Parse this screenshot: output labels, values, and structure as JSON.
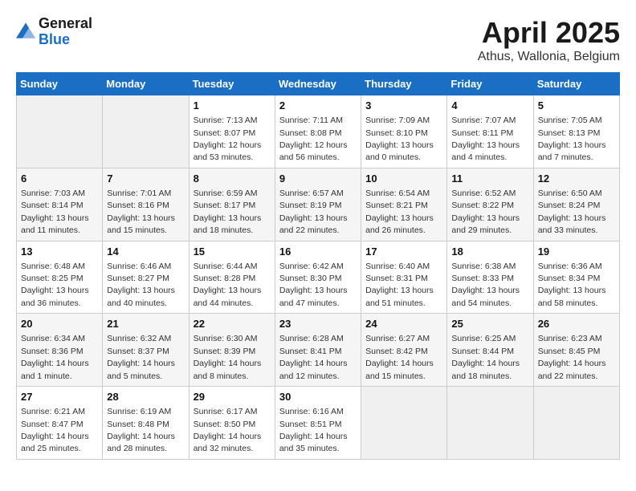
{
  "logo": {
    "general": "General",
    "blue": "Blue"
  },
  "header": {
    "title": "April 2025",
    "location": "Athus, Wallonia, Belgium"
  },
  "weekdays": [
    "Sunday",
    "Monday",
    "Tuesday",
    "Wednesday",
    "Thursday",
    "Friday",
    "Saturday"
  ],
  "weeks": [
    [
      {
        "day": "",
        "empty": true
      },
      {
        "day": "",
        "empty": true
      },
      {
        "day": "1",
        "sunrise": "Sunrise: 7:13 AM",
        "sunset": "Sunset: 8:07 PM",
        "daylight": "Daylight: 12 hours and 53 minutes."
      },
      {
        "day": "2",
        "sunrise": "Sunrise: 7:11 AM",
        "sunset": "Sunset: 8:08 PM",
        "daylight": "Daylight: 12 hours and 56 minutes."
      },
      {
        "day": "3",
        "sunrise": "Sunrise: 7:09 AM",
        "sunset": "Sunset: 8:10 PM",
        "daylight": "Daylight: 13 hours and 0 minutes."
      },
      {
        "day": "4",
        "sunrise": "Sunrise: 7:07 AM",
        "sunset": "Sunset: 8:11 PM",
        "daylight": "Daylight: 13 hours and 4 minutes."
      },
      {
        "day": "5",
        "sunrise": "Sunrise: 7:05 AM",
        "sunset": "Sunset: 8:13 PM",
        "daylight": "Daylight: 13 hours and 7 minutes."
      }
    ],
    [
      {
        "day": "6",
        "sunrise": "Sunrise: 7:03 AM",
        "sunset": "Sunset: 8:14 PM",
        "daylight": "Daylight: 13 hours and 11 minutes."
      },
      {
        "day": "7",
        "sunrise": "Sunrise: 7:01 AM",
        "sunset": "Sunset: 8:16 PM",
        "daylight": "Daylight: 13 hours and 15 minutes."
      },
      {
        "day": "8",
        "sunrise": "Sunrise: 6:59 AM",
        "sunset": "Sunset: 8:17 PM",
        "daylight": "Daylight: 13 hours and 18 minutes."
      },
      {
        "day": "9",
        "sunrise": "Sunrise: 6:57 AM",
        "sunset": "Sunset: 8:19 PM",
        "daylight": "Daylight: 13 hours and 22 minutes."
      },
      {
        "day": "10",
        "sunrise": "Sunrise: 6:54 AM",
        "sunset": "Sunset: 8:21 PM",
        "daylight": "Daylight: 13 hours and 26 minutes."
      },
      {
        "day": "11",
        "sunrise": "Sunrise: 6:52 AM",
        "sunset": "Sunset: 8:22 PM",
        "daylight": "Daylight: 13 hours and 29 minutes."
      },
      {
        "day": "12",
        "sunrise": "Sunrise: 6:50 AM",
        "sunset": "Sunset: 8:24 PM",
        "daylight": "Daylight: 13 hours and 33 minutes."
      }
    ],
    [
      {
        "day": "13",
        "sunrise": "Sunrise: 6:48 AM",
        "sunset": "Sunset: 8:25 PM",
        "daylight": "Daylight: 13 hours and 36 minutes."
      },
      {
        "day": "14",
        "sunrise": "Sunrise: 6:46 AM",
        "sunset": "Sunset: 8:27 PM",
        "daylight": "Daylight: 13 hours and 40 minutes."
      },
      {
        "day": "15",
        "sunrise": "Sunrise: 6:44 AM",
        "sunset": "Sunset: 8:28 PM",
        "daylight": "Daylight: 13 hours and 44 minutes."
      },
      {
        "day": "16",
        "sunrise": "Sunrise: 6:42 AM",
        "sunset": "Sunset: 8:30 PM",
        "daylight": "Daylight: 13 hours and 47 minutes."
      },
      {
        "day": "17",
        "sunrise": "Sunrise: 6:40 AM",
        "sunset": "Sunset: 8:31 PM",
        "daylight": "Daylight: 13 hours and 51 minutes."
      },
      {
        "day": "18",
        "sunrise": "Sunrise: 6:38 AM",
        "sunset": "Sunset: 8:33 PM",
        "daylight": "Daylight: 13 hours and 54 minutes."
      },
      {
        "day": "19",
        "sunrise": "Sunrise: 6:36 AM",
        "sunset": "Sunset: 8:34 PM",
        "daylight": "Daylight: 13 hours and 58 minutes."
      }
    ],
    [
      {
        "day": "20",
        "sunrise": "Sunrise: 6:34 AM",
        "sunset": "Sunset: 8:36 PM",
        "daylight": "Daylight: 14 hours and 1 minute."
      },
      {
        "day": "21",
        "sunrise": "Sunrise: 6:32 AM",
        "sunset": "Sunset: 8:37 PM",
        "daylight": "Daylight: 14 hours and 5 minutes."
      },
      {
        "day": "22",
        "sunrise": "Sunrise: 6:30 AM",
        "sunset": "Sunset: 8:39 PM",
        "daylight": "Daylight: 14 hours and 8 minutes."
      },
      {
        "day": "23",
        "sunrise": "Sunrise: 6:28 AM",
        "sunset": "Sunset: 8:41 PM",
        "daylight": "Daylight: 14 hours and 12 minutes."
      },
      {
        "day": "24",
        "sunrise": "Sunrise: 6:27 AM",
        "sunset": "Sunset: 8:42 PM",
        "daylight": "Daylight: 14 hours and 15 minutes."
      },
      {
        "day": "25",
        "sunrise": "Sunrise: 6:25 AM",
        "sunset": "Sunset: 8:44 PM",
        "daylight": "Daylight: 14 hours and 18 minutes."
      },
      {
        "day": "26",
        "sunrise": "Sunrise: 6:23 AM",
        "sunset": "Sunset: 8:45 PM",
        "daylight": "Daylight: 14 hours and 22 minutes."
      }
    ],
    [
      {
        "day": "27",
        "sunrise": "Sunrise: 6:21 AM",
        "sunset": "Sunset: 8:47 PM",
        "daylight": "Daylight: 14 hours and 25 minutes."
      },
      {
        "day": "28",
        "sunrise": "Sunrise: 6:19 AM",
        "sunset": "Sunset: 8:48 PM",
        "daylight": "Daylight: 14 hours and 28 minutes."
      },
      {
        "day": "29",
        "sunrise": "Sunrise: 6:17 AM",
        "sunset": "Sunset: 8:50 PM",
        "daylight": "Daylight: 14 hours and 32 minutes."
      },
      {
        "day": "30",
        "sunrise": "Sunrise: 6:16 AM",
        "sunset": "Sunset: 8:51 PM",
        "daylight": "Daylight: 14 hours and 35 minutes."
      },
      {
        "day": "",
        "empty": true
      },
      {
        "day": "",
        "empty": true
      },
      {
        "day": "",
        "empty": true
      }
    ]
  ]
}
